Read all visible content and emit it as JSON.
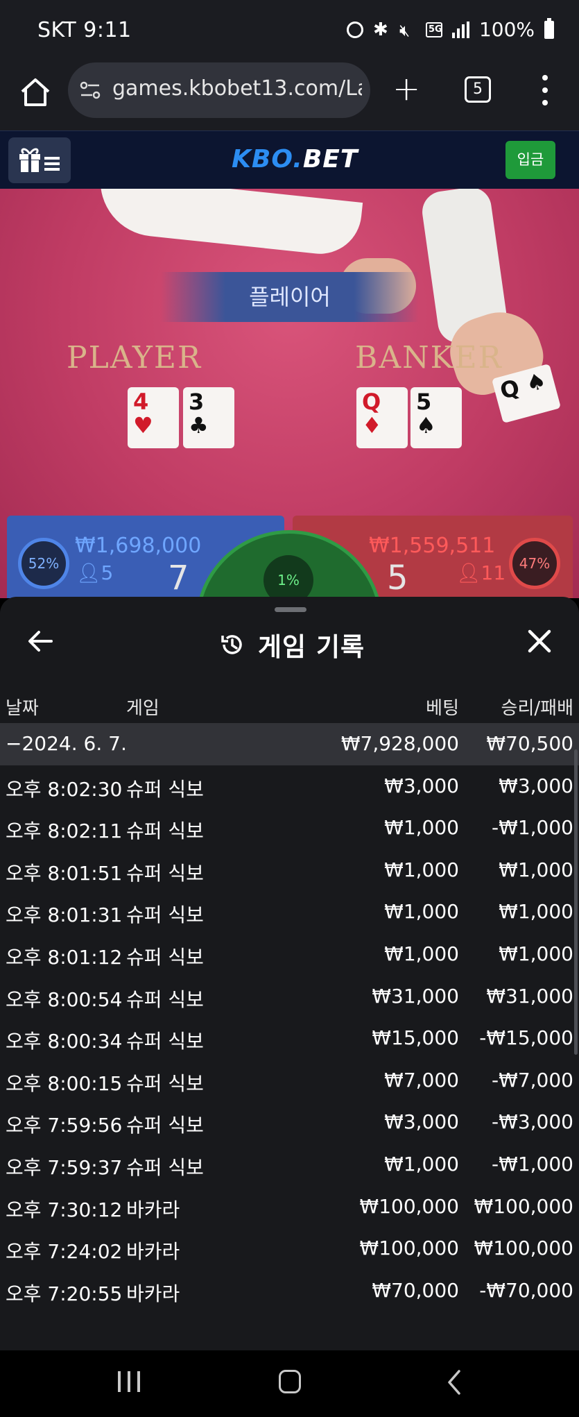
{
  "status_bar": {
    "carrier_time": "SKT 9:11",
    "network": "5G",
    "battery": "100%"
  },
  "browser": {
    "url": "games.kbobet13.com/Lau",
    "tab_count": "5"
  },
  "site": {
    "logo_prefix": "KBO",
    "logo_dot": ".",
    "logo_suffix": "BET",
    "deposit_label": "입금"
  },
  "game": {
    "banner": "플레이어",
    "player_label": "PLAYER",
    "banker_label": "BANKER",
    "player_cards": [
      {
        "rank": "4",
        "suit": "♥",
        "color": "red"
      },
      {
        "rank": "3",
        "suit": "♣",
        "color": "black"
      }
    ],
    "banker_cards": [
      {
        "rank": "Q",
        "suit": "♦",
        "color": "red"
      },
      {
        "rank": "5",
        "suit": "♠",
        "color": "black"
      },
      {
        "rank": "Q",
        "suit": "♠",
        "color": "black"
      }
    ],
    "player": {
      "percent": "52%",
      "amount": "₩1,698,000",
      "bettors": "5",
      "score": "7"
    },
    "banker": {
      "percent": "47%",
      "amount": "₩1,559,511",
      "bettors": "11",
      "score": "5"
    },
    "tie_percent": "1%",
    "colors": {
      "player": "#3a5eb5",
      "banker": "#b23a44",
      "tie": "#1f6b2e"
    }
  },
  "history": {
    "title": "게임 기록",
    "columns": {
      "date": "날짜",
      "game": "게임",
      "bet": "베팅",
      "result": "승리/패배"
    },
    "group": {
      "date": "−2024. 6. 7.",
      "bet": "₩7,928,000",
      "result": "₩70,500"
    },
    "rows": [
      {
        "time": "오후 8:02:30",
        "game": "슈퍼 식보",
        "bet": "₩3,000",
        "result": "₩3,000"
      },
      {
        "time": "오후 8:02:11",
        "game": "슈퍼 식보",
        "bet": "₩1,000",
        "result": "-₩1,000"
      },
      {
        "time": "오후 8:01:51",
        "game": "슈퍼 식보",
        "bet": "₩1,000",
        "result": "₩1,000"
      },
      {
        "time": "오후 8:01:31",
        "game": "슈퍼 식보",
        "bet": "₩1,000",
        "result": "₩1,000"
      },
      {
        "time": "오후 8:01:12",
        "game": "슈퍼 식보",
        "bet": "₩1,000",
        "result": "₩1,000"
      },
      {
        "time": "오후 8:00:54",
        "game": "슈퍼 식보",
        "bet": "₩31,000",
        "result": "₩31,000"
      },
      {
        "time": "오후 8:00:34",
        "game": "슈퍼 식보",
        "bet": "₩15,000",
        "result": "-₩15,000"
      },
      {
        "time": "오후 8:00:15",
        "game": "슈퍼 식보",
        "bet": "₩7,000",
        "result": "-₩7,000"
      },
      {
        "time": "오후 7:59:56",
        "game": "슈퍼 식보",
        "bet": "₩3,000",
        "result": "-₩3,000"
      },
      {
        "time": "오후 7:59:37",
        "game": "슈퍼 식보",
        "bet": "₩1,000",
        "result": "-₩1,000"
      },
      {
        "time": "오후 7:30:12",
        "game": "바카라",
        "bet": "₩100,000",
        "result": "₩100,000"
      },
      {
        "time": "오후 7:24:02",
        "game": "바카라",
        "bet": "₩100,000",
        "result": "₩100,000"
      },
      {
        "time": "오후 7:20:55",
        "game": "바카라",
        "bet": "₩70,000",
        "result": "-₩70,000"
      }
    ]
  }
}
